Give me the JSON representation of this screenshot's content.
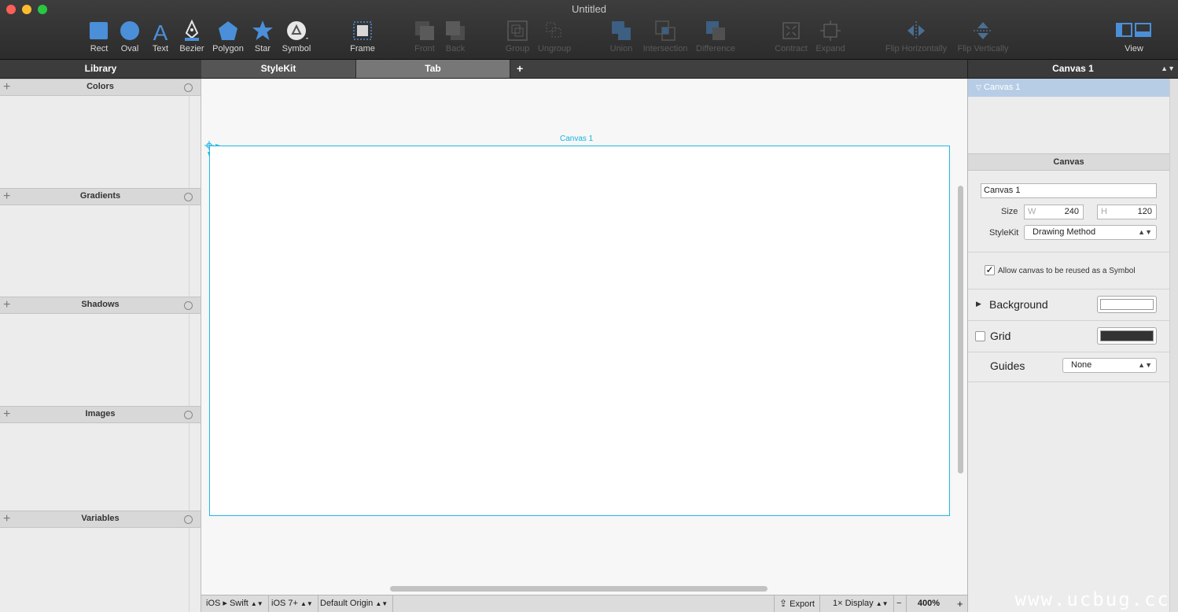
{
  "window": {
    "title": "Untitled"
  },
  "toolbar": {
    "tools": [
      {
        "label": "Rect",
        "icon": "rect-icon"
      },
      {
        "label": "Oval",
        "icon": "oval-icon"
      },
      {
        "label": "Text",
        "icon": "text-icon"
      },
      {
        "label": "Bezier",
        "icon": "bezier-pen-icon"
      },
      {
        "label": "Polygon",
        "icon": "polygon-icon"
      },
      {
        "label": "Star",
        "icon": "star-icon"
      },
      {
        "label": "Symbol",
        "icon": "symbol-icon"
      },
      {
        "label": "Frame",
        "icon": "frame-icon"
      },
      {
        "label": "Front",
        "icon": "bring-front-icon"
      },
      {
        "label": "Back",
        "icon": "send-back-icon"
      },
      {
        "label": "Group",
        "icon": "group-icon"
      },
      {
        "label": "Ungroup",
        "icon": "ungroup-icon"
      },
      {
        "label": "Union",
        "icon": "union-icon"
      },
      {
        "label": "Intersection",
        "icon": "intersection-icon"
      },
      {
        "label": "Difference",
        "icon": "difference-icon"
      },
      {
        "label": "Contract",
        "icon": "contract-icon"
      },
      {
        "label": "Expand",
        "icon": "expand-icon"
      },
      {
        "label": "Flip Horizontally",
        "icon": "flip-horizontal-icon"
      },
      {
        "label": "Flip Vertically",
        "icon": "flip-vertical-icon"
      },
      {
        "label": "View",
        "icon": "view-icon"
      }
    ]
  },
  "library": {
    "title": "Library",
    "sections": [
      "Colors",
      "Gradients",
      "Shadows",
      "Images",
      "Variables"
    ]
  },
  "tabs": {
    "items": [
      "StyleKit",
      "Tab"
    ],
    "add": "+"
  },
  "canvas": {
    "name": "Canvas 1"
  },
  "statusbar": {
    "platform": "iOS ▸ Swift",
    "version": "iOS 7+",
    "origin": "Default Origin",
    "export": "Export",
    "display": "1× Display",
    "zoom_minus": "−",
    "zoom": "400%",
    "zoom_plus": "+"
  },
  "inspector": {
    "header": "Canvas 1",
    "tree_item": "Canvas 1",
    "section_title": "Canvas",
    "name_value": "Canvas 1",
    "size_label": "Size",
    "width_label": "W",
    "width_value": "240",
    "height_label": "H",
    "height_value": "120",
    "stylekit_label": "StyleKit",
    "stylekit_value": "Drawing Method",
    "reuse_checkbox": "Allow canvas to be reused as a Symbol",
    "reuse_checked": true,
    "background_label": "Background",
    "background_color": "#ffffff",
    "grid_label": "Grid",
    "grid_checked": false,
    "grid_color": "#333333",
    "guides_label": "Guides",
    "guides_value": "None"
  },
  "watermark": "www.ucbug.cc",
  "colors": {
    "accent": "#20b8e6",
    "icon_blue": "#4a8fd8"
  }
}
